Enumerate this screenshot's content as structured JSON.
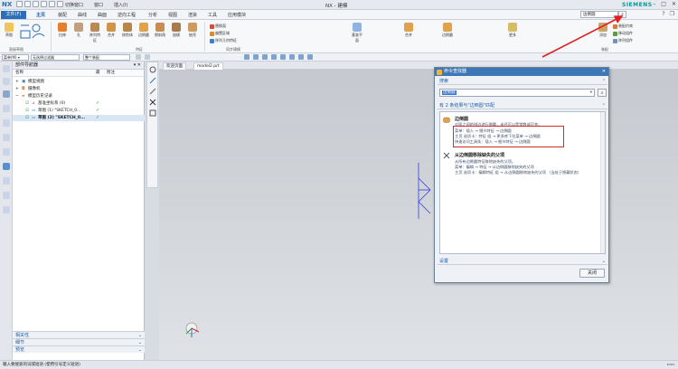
{
  "titlebar": {
    "logo": "NX",
    "items": [
      "切换窗口",
      "窗口",
      "插入(I)"
    ],
    "title": "NX - 建模",
    "brand": "SIEMENS"
  },
  "tabs": {
    "file": "文件(F)",
    "items": [
      "主页",
      "装配",
      "曲线",
      "曲面",
      "逆向工程",
      "分析",
      "视图",
      "渲染",
      "工具",
      "应用模块"
    ],
    "search_value": "边倒圆",
    "search_icon": "search-icon"
  },
  "ribbon": {
    "buttons": [
      "草图",
      "拉伸",
      "孔",
      "阵列特征",
      "合并",
      "修剪体",
      "边倒圆",
      "倒斜角",
      "拔模",
      "抽壳",
      "更多",
      "添加"
    ],
    "groups": [
      "直接草图",
      "特征",
      "同步建模",
      "装配"
    ],
    "small": [
      "草图曲线",
      "基准平面",
      "阵列几何特征",
      "替换面",
      "偏置区域",
      "移动组件",
      "阵列组件",
      "装配约束"
    ]
  },
  "toolbar2": {
    "menu_label": "菜单(M) ▾",
    "filter": "无选择过滤器",
    "scope": "整个装配"
  },
  "navigator": {
    "title": "部件导航器",
    "columns": [
      "名称",
      "最",
      "附注"
    ],
    "rows": [
      "模型视图",
      "摄像机",
      "模型历史记录",
      "基准坐标系 (0)",
      "草图 (1) \"SKETCH_0...",
      "草图 (2) \"SKETCH_0..."
    ],
    "footer": [
      "相关性",
      "细节",
      "预览"
    ]
  },
  "doc_tabs": [
    "欢迎页面",
    "model2.prt"
  ],
  "dialog": {
    "title": "命令查找器",
    "search_section": "搜索",
    "search_value": "边倒圆",
    "results_header": "有 2 条结果与\"边倒圆\"匹配",
    "result1": {
      "title": "边倒圆",
      "desc": "对面之间的锐边进行倒圆，半径可以是常数或可变。",
      "menu": "菜单：插入 → 细节特征 → 边倒圆",
      "tab": "主页 选项卡：特征 组 → 更多库下拉菜单 → 边倒圆",
      "quick": "快速访问工具条：插入 → 细节特征 → 边倒圆"
    },
    "result2": {
      "title": "从边倒圆移除缺失的父项",
      "desc": "从所有边倒圆特征移除缺失的父项。",
      "menu": "菜单：编辑 → 特征 → 从边倒圆移除缺失的父项",
      "tab": "主页 选项卡：编辑特征 组 → 从边倒圆移除缺失的父项 （当处于隐藏状态）"
    },
    "settings_section": "设置",
    "close_label": "关闭"
  },
  "status": {
    "text": "输入要搜索的词或短语 (使用引号定义短语)"
  }
}
